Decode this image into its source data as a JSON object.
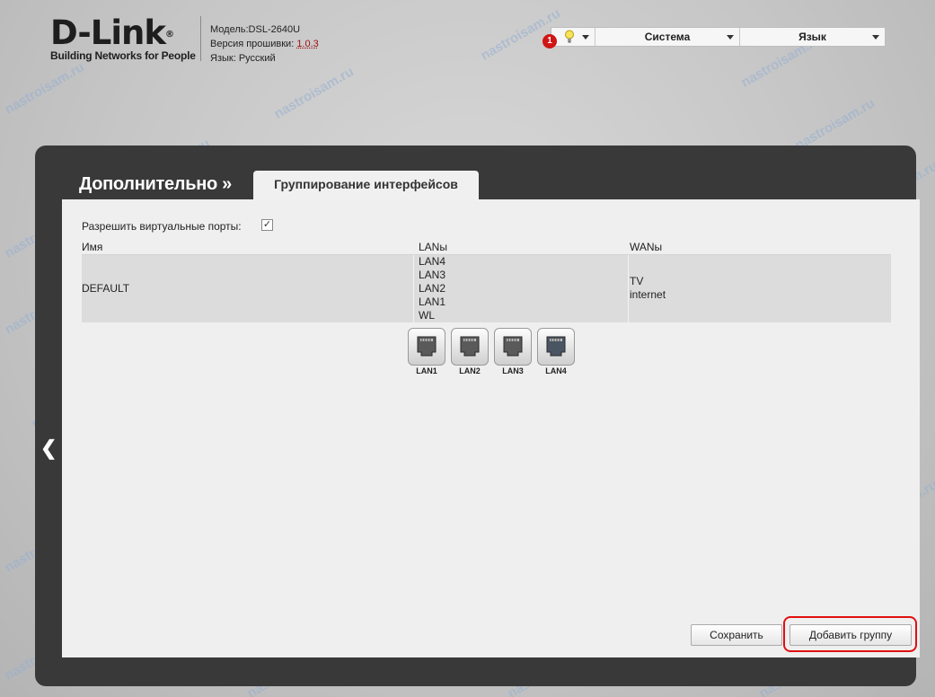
{
  "brand": {
    "logo": "D-Link",
    "registered": "®",
    "tagline": "Building Networks for People"
  },
  "device": {
    "model_label": "Модель:",
    "model": "DSL-2640U",
    "firmware_label": "Версия прошивки:",
    "firmware": "1.0.3",
    "language_label": "Язык:",
    "language": "Русский"
  },
  "topmenu": {
    "notifications_count": "1",
    "system_label": "Система",
    "language_label": "Язык"
  },
  "page": {
    "title": "Дополнительно »",
    "tab": "Группирование интерфейсов",
    "back_arrow": "❮"
  },
  "form": {
    "virtual_ports_label": "Разрешить виртуальные порты:",
    "virtual_ports_checked": true,
    "check_mark": "✓"
  },
  "table": {
    "headers": {
      "name": "Имя",
      "lans": "LANы",
      "wans": "WANы"
    },
    "rows": [
      {
        "name": "DEFAULT",
        "lans": [
          "LAN4",
          "LAN3",
          "LAN2",
          "LAN1",
          "WL"
        ],
        "wans": [
          "TV",
          "internet"
        ]
      }
    ]
  },
  "ports": [
    "LAN1",
    "LAN2",
    "LAN3",
    "LAN4"
  ],
  "buttons": {
    "save": "Сохранить",
    "add_group": "Добавить группу"
  },
  "watermark": "nastroisam.ru",
  "colors": {
    "panel": "#393939",
    "content": "#efefef",
    "highlight": "#e01010",
    "badge": "#d01515"
  }
}
